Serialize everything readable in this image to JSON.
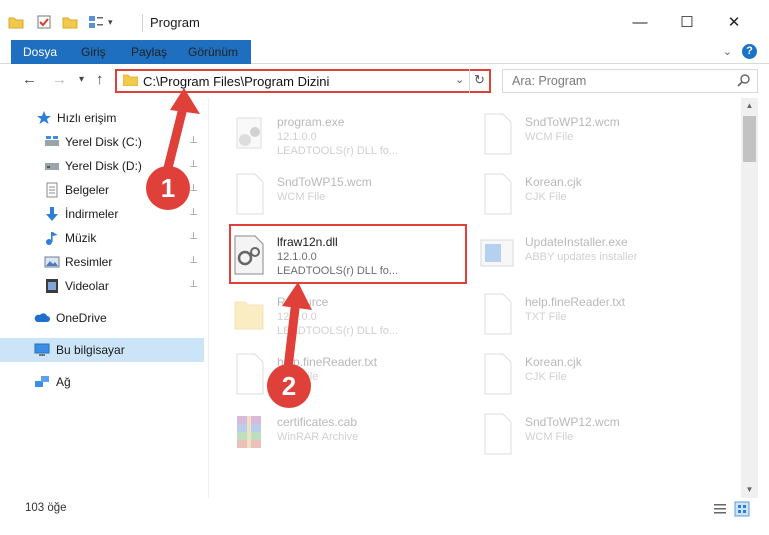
{
  "window": {
    "title": "Program",
    "minimize": "—",
    "maximize": "☐",
    "close": "✕"
  },
  "ribbon": {
    "tabs": [
      "Dosya",
      "Giriş",
      "Paylaş",
      "Görünüm"
    ],
    "expand_icon": "chevron-down-icon",
    "help": "?"
  },
  "nav": {
    "back": "←",
    "forward": "→",
    "recent": "▾",
    "up": "↑"
  },
  "address": {
    "path": "C:\\Program Files\\Program Dizini",
    "dropdown": "⌄",
    "refresh": "↻"
  },
  "search": {
    "placeholder": "Ara: Program"
  },
  "sidebar": {
    "items": [
      {
        "label": "Hızlı erişim",
        "icon": "star-icon",
        "pinned": false
      },
      {
        "label": "Yerel Disk (C:)",
        "icon": "drive-icon",
        "pinned": true
      },
      {
        "label": "Yerel Disk (D:)",
        "icon": "drive-icon",
        "pinned": true
      },
      {
        "label": "Belgeler",
        "icon": "documents-icon",
        "pinned": true
      },
      {
        "label": "İndirmeler",
        "icon": "download-icon",
        "pinned": true
      },
      {
        "label": "Müzik",
        "icon": "music-icon",
        "pinned": true
      },
      {
        "label": "Resimler",
        "icon": "pictures-icon",
        "pinned": true
      },
      {
        "label": "Videolar",
        "icon": "videos-icon",
        "pinned": true
      },
      {
        "label": "OneDrive",
        "icon": "cloud-icon",
        "pinned": false
      },
      {
        "label": "Bu bilgisayar",
        "icon": "computer-icon",
        "pinned": false,
        "selected": true
      },
      {
        "label": "Ağ",
        "icon": "network-icon",
        "pinned": false
      }
    ],
    "pin_glyph": "📌"
  },
  "files": [
    {
      "name": "program.exe",
      "line2": "12.1.0.0",
      "line3": "LEADTOOLS(r) DLL fo...",
      "icon": "exe-icon",
      "faded": true
    },
    {
      "name": "SndToWP12.wcm",
      "line2": "WCM File",
      "line3": "",
      "icon": "blank-file-icon",
      "faded": true
    },
    {
      "name": "SndToWP15.wcm",
      "line2": "WCM File",
      "line3": "",
      "icon": "blank-file-icon",
      "faded": true
    },
    {
      "name": "Korean.cjk",
      "line2": "CJK File",
      "line3": "",
      "icon": "blank-file-icon",
      "faded": true
    },
    {
      "name": "lfraw12n.dll",
      "line2": "12.1.0.0",
      "line3": "LEADTOOLS(r) DLL fo...",
      "icon": "dll-gear-icon",
      "faded": false,
      "highlighted": true
    },
    {
      "name": "UpdateInstaller.exe",
      "line2": "ABBY updates installer",
      "line3": "",
      "icon": "installer-icon",
      "faded": true
    },
    {
      "name": "Resource",
      "line2": "12.1.0.0",
      "line3": "LEADTOOLS(r) DLL fo...",
      "icon": "folder-icon",
      "faded": true
    },
    {
      "name": "help.fineReader.txt",
      "line2": "TXT File",
      "line3": "",
      "icon": "blank-file-icon",
      "faded": true
    },
    {
      "name": "help.fineReader.txt",
      "line2": "TXT File",
      "line3": "",
      "icon": "blank-file-icon",
      "faded": true
    },
    {
      "name": "Korean.cjk",
      "line2": "CJK File",
      "line3": "",
      "icon": "blank-file-icon",
      "faded": true
    },
    {
      "name": "certificates.cab",
      "line2": "WinRAR Archive",
      "line3": "",
      "icon": "winrar-icon",
      "faded": true
    },
    {
      "name": "SndToWP12.wcm",
      "line2": "WCM File",
      "line3": "",
      "icon": "blank-file-icon",
      "faded": true
    }
  ],
  "status": {
    "count": "103 öğe"
  },
  "annotations": {
    "callout_1": "1",
    "callout_2": "2",
    "color": "#e0403a"
  },
  "colors": {
    "accent": "#1e6fbf",
    "selected_bg": "#cce4f7",
    "highlight": "#e0403a"
  }
}
